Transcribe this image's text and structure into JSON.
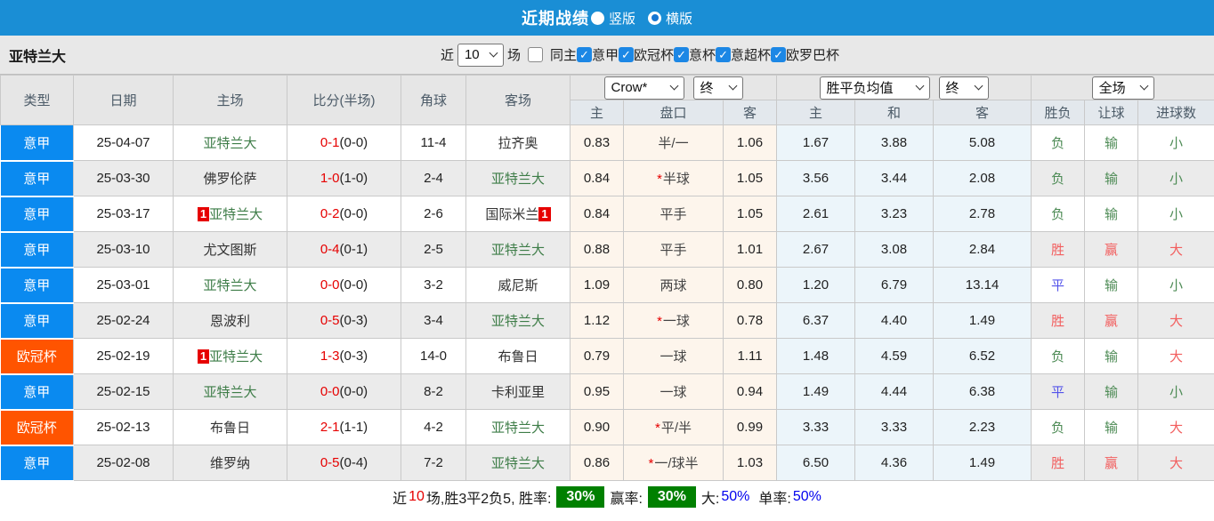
{
  "topbar": {
    "title": "近期战绩",
    "radio_vertical_label": "竖版",
    "radio_horizontal_label": "横版",
    "selected_layout": "横版"
  },
  "filter": {
    "team": "亚特兰大",
    "near_label": "近",
    "count_value": "10",
    "games_label": "场",
    "same_venue_label": "同主",
    "same_venue_checked": false,
    "leagues": [
      "意甲",
      "欧冠杯",
      "意杯",
      "意超杯",
      "欧罗巴杯"
    ],
    "leagues_checked": [
      true,
      true,
      true,
      true,
      true
    ]
  },
  "table": {
    "main_headers": [
      "类型",
      "日期",
      "主场",
      "比分(半场)",
      "角球",
      "客场"
    ],
    "bookmaker_select": "Crow*",
    "bookmaker_state_select": "终",
    "europe_select": "胜平负均值",
    "europe_state_select": "终",
    "scope_select": "全场",
    "sub_headers": [
      "主",
      "盘口",
      "客",
      "主",
      "和",
      "客",
      "胜负",
      "让球",
      "进球数"
    ],
    "rows": [
      {
        "league": "意甲",
        "date": "25-04-07",
        "home": "亚特兰大",
        "home_badge": "",
        "score": "0-1",
        "half": "(0-0)",
        "corners": "11-4",
        "away": "拉齐奥",
        "away_badge": "",
        "h_odds": "0.83",
        "handicap": "半/一",
        "handicap_star": false,
        "a_odds": "1.06",
        "win": "1.67",
        "draw": "3.88",
        "lose": "5.08",
        "result": "负",
        "handicap_result": "输",
        "goals": "小"
      },
      {
        "league": "意甲",
        "date": "25-03-30",
        "home": "佛罗伦萨",
        "home_badge": "",
        "score": "1-0",
        "half": "(1-0)",
        "corners": "2-4",
        "away": "亚特兰大",
        "away_badge": "",
        "h_odds": "0.84",
        "handicap": "半球",
        "handicap_star": true,
        "a_odds": "1.05",
        "win": "3.56",
        "draw": "3.44",
        "lose": "2.08",
        "result": "负",
        "handicap_result": "输",
        "goals": "小"
      },
      {
        "league": "意甲",
        "date": "25-03-17",
        "home": "亚特兰大",
        "home_badge": "1",
        "score": "0-2",
        "half": "(0-0)",
        "corners": "2-6",
        "away": "国际米兰",
        "away_badge": "1",
        "h_odds": "0.84",
        "handicap": "平手",
        "handicap_star": false,
        "a_odds": "1.05",
        "win": "2.61",
        "draw": "3.23",
        "lose": "2.78",
        "result": "负",
        "handicap_result": "输",
        "goals": "小"
      },
      {
        "league": "意甲",
        "date": "25-03-10",
        "home": "尤文图斯",
        "home_badge": "",
        "score": "0-4",
        "half": "(0-1)",
        "corners": "2-5",
        "away": "亚特兰大",
        "away_badge": "",
        "h_odds": "0.88",
        "handicap": "平手",
        "handicap_star": false,
        "a_odds": "1.01",
        "win": "2.67",
        "draw": "3.08",
        "lose": "2.84",
        "result": "胜",
        "handicap_result": "赢",
        "goals": "大"
      },
      {
        "league": "意甲",
        "date": "25-03-01",
        "home": "亚特兰大",
        "home_badge": "",
        "score": "0-0",
        "half": "(0-0)",
        "corners": "3-2",
        "away": "威尼斯",
        "away_badge": "",
        "h_odds": "1.09",
        "handicap": "两球",
        "handicap_star": false,
        "a_odds": "0.80",
        "win": "1.20",
        "draw": "6.79",
        "lose": "13.14",
        "result": "平",
        "handicap_result": "输",
        "goals": "小"
      },
      {
        "league": "意甲",
        "date": "25-02-24",
        "home": "恩波利",
        "home_badge": "",
        "score": "0-5",
        "half": "(0-3)",
        "corners": "3-4",
        "away": "亚特兰大",
        "away_badge": "",
        "h_odds": "1.12",
        "handicap": "一球",
        "handicap_star": true,
        "a_odds": "0.78",
        "win": "6.37",
        "draw": "4.40",
        "lose": "1.49",
        "result": "胜",
        "handicap_result": "赢",
        "goals": "大"
      },
      {
        "league": "欧冠杯",
        "date": "25-02-19",
        "home": "亚特兰大",
        "home_badge": "1",
        "score": "1-3",
        "half": "(0-3)",
        "corners": "14-0",
        "away": "布鲁日",
        "away_badge": "",
        "h_odds": "0.79",
        "handicap": "一球",
        "handicap_star": false,
        "a_odds": "1.11",
        "win": "1.48",
        "draw": "4.59",
        "lose": "6.52",
        "result": "负",
        "handicap_result": "输",
        "goals": "大"
      },
      {
        "league": "意甲",
        "date": "25-02-15",
        "home": "亚特兰大",
        "home_badge": "",
        "score": "0-0",
        "half": "(0-0)",
        "corners": "8-2",
        "away": "卡利亚里",
        "away_badge": "",
        "h_odds": "0.95",
        "handicap": "一球",
        "handicap_star": false,
        "a_odds": "0.94",
        "win": "1.49",
        "draw": "4.44",
        "lose": "6.38",
        "result": "平",
        "handicap_result": "输",
        "goals": "小"
      },
      {
        "league": "欧冠杯",
        "date": "25-02-13",
        "home": "布鲁日",
        "home_badge": "",
        "score": "2-1",
        "half": "(1-1)",
        "corners": "4-2",
        "away": "亚特兰大",
        "away_badge": "",
        "h_odds": "0.90",
        "handicap": "平/半",
        "handicap_star": true,
        "a_odds": "0.99",
        "win": "3.33",
        "draw": "3.33",
        "lose": "2.23",
        "result": "负",
        "handicap_result": "输",
        "goals": "大"
      },
      {
        "league": "意甲",
        "date": "25-02-08",
        "home": "维罗纳",
        "home_badge": "",
        "score": "0-5",
        "half": "(0-4)",
        "corners": "7-2",
        "away": "亚特兰大",
        "away_badge": "",
        "h_odds": "0.86",
        "handicap": "一/球半",
        "handicap_star": true,
        "a_odds": "1.03",
        "win": "6.50",
        "draw": "4.36",
        "lose": "1.49",
        "result": "胜",
        "handicap_result": "赢",
        "goals": "大"
      }
    ]
  },
  "summary": {
    "prefix": "近",
    "count": "10",
    "middle": "场,胜3平2负5, 胜率:",
    "win_rate": "30%",
    "cover_label": "赢率:",
    "cover_rate": "30%",
    "big_label": "大:",
    "big_value": "50%",
    "single_label": "单率:",
    "single_value": "50%"
  },
  "colors": {
    "topbar_bg": "#1a8ed5",
    "league": {
      "意甲": "#0a8af0",
      "欧冠杯": "#ff5400"
    },
    "focus_team": "#3e7d48",
    "other_team": "#333333",
    "score_red": "#e60000",
    "outcome": {
      "胜": "#f25e5e",
      "赢": "#f25e5e",
      "大": "#f25e5e",
      "负": "#4d8b55",
      "输": "#4d8b55",
      "小": "#4d8b55",
      "平": "#5353ea"
    },
    "rate_badge_bg": "#008000",
    "rate_value_blue": "#0000ee"
  }
}
